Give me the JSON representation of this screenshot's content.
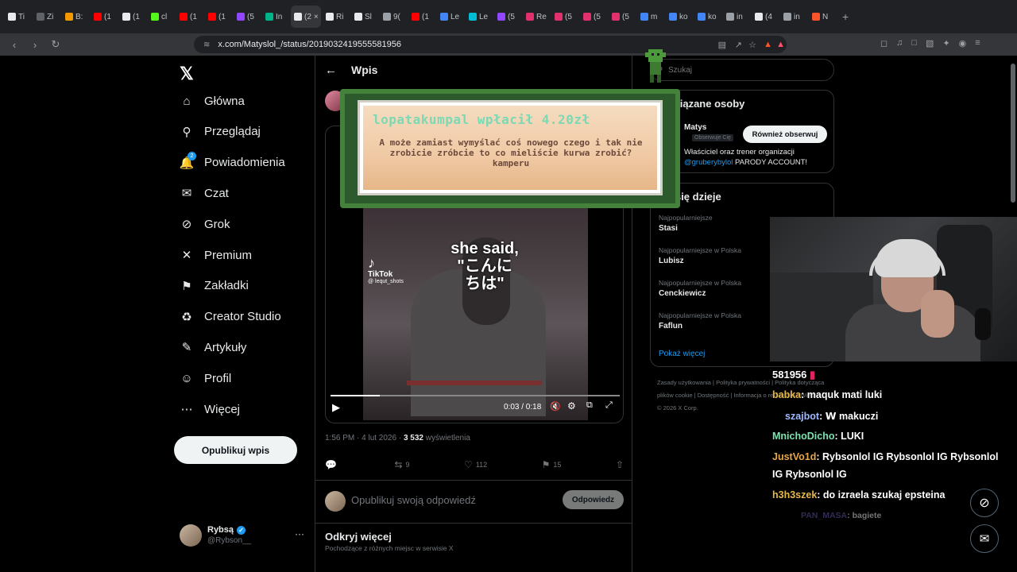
{
  "browser": {
    "tabs": [
      {
        "label": "Ti",
        "icon": "generic-tab-icon",
        "color": "#e8eaed"
      },
      {
        "label": "Zi",
        "icon": "generic-tab-icon",
        "color": "#5f6368"
      },
      {
        "label": "B:",
        "icon": "generic-tab-icon",
        "color": "#f29900"
      },
      {
        "label": "(1",
        "icon": "youtube-icon",
        "color": "#ff0000"
      },
      {
        "label": "(1",
        "icon": "x-icon",
        "color": "#e8eaed"
      },
      {
        "label": "cl",
        "icon": "kick-icon",
        "color": "#53fc18"
      },
      {
        "label": "(1",
        "icon": "youtube-icon",
        "color": "#ff0000"
      },
      {
        "label": "(1",
        "icon": "youtube-icon",
        "color": "#ff0000"
      },
      {
        "label": "(5",
        "icon": "twitch-icon",
        "color": "#9146ff"
      },
      {
        "label": "In",
        "icon": "generic-tab-icon",
        "color": "#00b388"
      },
      {
        "label": "(2",
        "icon": "x-icon",
        "color": "#e8eaed",
        "active": true
      },
      {
        "label": "Ri",
        "icon": "x-icon",
        "color": "#e8eaed"
      },
      {
        "label": "Sl",
        "icon": "generic-tab-icon",
        "color": "#e8eaed"
      },
      {
        "label": "9(",
        "icon": "globe-icon",
        "color": "#9aa0a6"
      },
      {
        "label": "(1",
        "icon": "youtube-icon",
        "color": "#ff0000"
      },
      {
        "label": "Le",
        "icon": "generic-tab-icon",
        "color": "#4285f4"
      },
      {
        "label": "Le",
        "icon": "generic-tab-icon",
        "color": "#00bcd4"
      },
      {
        "label": "(5",
        "icon": "twitch-icon",
        "color": "#9146ff"
      },
      {
        "label": "Re",
        "icon": "instagram-icon",
        "color": "#e1306c"
      },
      {
        "label": "(5",
        "icon": "instagram-icon",
        "color": "#e1306c"
      },
      {
        "label": "(5",
        "icon": "instagram-icon",
        "color": "#e1306c"
      },
      {
        "label": "(5",
        "icon": "instagram-icon",
        "color": "#e1306c"
      },
      {
        "label": "m",
        "icon": "google-icon",
        "color": "#4285f4"
      },
      {
        "label": "ko",
        "icon": "google-icon",
        "color": "#4285f4"
      },
      {
        "label": "ko",
        "icon": "google-icon",
        "color": "#4285f4"
      },
      {
        "label": "in",
        "icon": "globe-icon",
        "color": "#9aa0a6"
      },
      {
        "label": "(4",
        "icon": "x-icon",
        "color": "#e8eaed"
      },
      {
        "label": "in",
        "icon": "globe-icon",
        "color": "#9aa0a6"
      },
      {
        "label": "N",
        "icon": "brave-icon",
        "color": "#fb542b"
      }
    ],
    "url": "x.com/Matyslol_/status/2019032419555581956"
  },
  "sidebar": {
    "logo": "𝕏",
    "items": [
      {
        "label": "Główna",
        "icon": "home-icon"
      },
      {
        "label": "Przeglądaj",
        "icon": "search-icon"
      },
      {
        "label": "Powiadomienia",
        "icon": "bell-icon",
        "badge": "2"
      },
      {
        "label": "Czat",
        "icon": "mail-icon"
      },
      {
        "label": "Grok",
        "icon": "grok-icon"
      },
      {
        "label": "Premium",
        "icon": "x-premium-icon"
      },
      {
        "label": "Zakładki",
        "icon": "bookmark-icon"
      },
      {
        "label": "Creator Studio",
        "icon": "creator-studio-icon"
      },
      {
        "label": "Artykuły",
        "icon": "articles-icon"
      },
      {
        "label": "Profil",
        "icon": "person-icon"
      },
      {
        "label": "Więcej",
        "icon": "more-circle-icon"
      }
    ],
    "publish": "Opublikuj wpis",
    "profile": {
      "name": "Rybsą",
      "handle": "@Rybson__",
      "more": "···"
    }
  },
  "post": {
    "header": "Wpis",
    "video": {
      "caption_line1": "she said,",
      "caption_line2": "\"こんに",
      "caption_line3": "ちは\"",
      "watermark": "TikTok",
      "watermark_handle": "@ lequt_shots",
      "time": "0:03 / 0:18",
      "progress": 0.17
    },
    "timestamp": "1:56 PM · 4 lut 2026 · ",
    "views_count": "3 532",
    "views_label": " wyświetlenia",
    "actions": {
      "replies": "",
      "reposts": "9",
      "likes": "112",
      "bookmarks": "15"
    },
    "reply_placeholder": "Opublikuj swoją odpowiedź",
    "reply_button": "Odpowiedz",
    "discover_title": "Odkryj więcej",
    "discover_sub": "Pochodzące z różnych miejsc w serwisie X"
  },
  "right": {
    "search_placeholder": "Szukaj",
    "related_title": "Powiązane osoby",
    "related_name": "Matys",
    "related_follows_you": "Obserwuje Cię",
    "related_follow_btn": "Również obserwuj",
    "related_bio": "Właściciel oraz trener organizacji ",
    "related_bio_link": "@gruberybylol",
    "related_bio_end": " PARODY ACCOUNT!",
    "trends_title": "Co się dzieje",
    "trends": [
      {
        "meta": "Najpopularniejsze",
        "name": "Stasi"
      },
      {
        "meta": "Najpopularniejsze w Polska",
        "name": "Lubisz"
      },
      {
        "meta": "Najpopularniejsze w Polska",
        "name": "Cenckiewicz"
      },
      {
        "meta": "Najpopularniejsze w Polska",
        "name": "Faflun"
      }
    ],
    "show_more": "Pokaż więcej",
    "footer": "Zasady użytkowania | Polityka prywatności | Polityka dotycząca plików cookie | Dostępność | Informacja o reklamach | Więcej ··· © 2026 X Corp."
  },
  "overlay": {
    "title": "lopatakumpal wpłacił 4.20zł",
    "message": "A może zamiast wymyślać coś nowego czego i tak nie zrobicie zróbcie to co mieliście kurwa zrobić? kamperu"
  },
  "stream_chat": {
    "counter": "581956",
    "lines": [
      {
        "user": "babka",
        "color": "#e6b84a",
        "text": ": maquk mati luki"
      },
      {
        "user": "szajbot",
        "color": "#9fb8ff",
        "text": ": 𝗪 makuczi"
      },
      {
        "user": "MnichoDicho",
        "color": "#7de3b0",
        "text": ": LUKI"
      },
      {
        "user": "JustVo1d",
        "color": "#e6a64a",
        "text": ": Rybsonlol IG Rybsonlol IG Rybsonlol"
      },
      {
        "user": "",
        "color": "#ffffff",
        "text": "IG Rybsonlol IG"
      },
      {
        "user": "h3h3szek",
        "color": "#e6b84a",
        "text": ": do izraela szukaj epsteina"
      },
      {
        "user": "PAN_MASA",
        "color": "#6f5fbf",
        "text": ": bagiete"
      }
    ]
  }
}
